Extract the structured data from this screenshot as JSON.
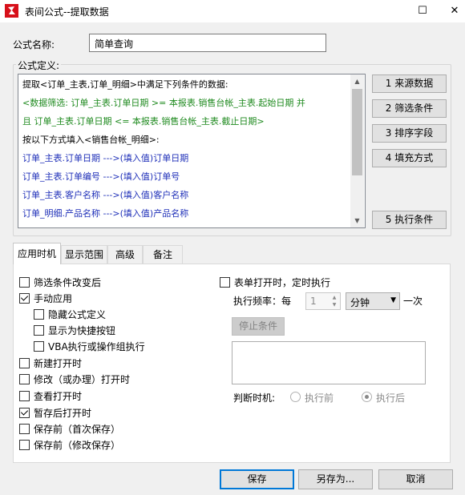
{
  "window": {
    "title": "表间公式--提取数据",
    "maximize_glyph": "☐",
    "close_glyph": "✕"
  },
  "form": {
    "name_label": "公式名称:",
    "name_value": "简单查询",
    "definition_label": "公式定义:"
  },
  "formula": {
    "lines": [
      {
        "color": "black",
        "text": "提取<订单_主表,订单_明细>中满足下列条件的数据:"
      },
      {
        "color": "green",
        "text": "    <数据筛选: 订单_主表.订单日期 >= 本报表.销售台帐_主表.起始日期    并"
      },
      {
        "color": "green",
        "text": "且 订单_主表.订单日期 <= 本报表.销售台帐_主表.截止日期>"
      },
      {
        "color": "black",
        "text": "按以下方式填入<销售台帐_明细>:"
      },
      {
        "color": "blue",
        "text": "订单_主表.订单日期  --->(填入值)订单日期"
      },
      {
        "color": "blue",
        "text": "订单_主表.订单编号  --->(填入值)订单号"
      },
      {
        "color": "blue",
        "text": "订单_主表.客户名称  --->(填入值)客户名称"
      },
      {
        "color": "blue",
        "text": "订单_明细.产品名称  --->(填入值)产品名称"
      }
    ]
  },
  "side_buttons": {
    "source": "1  来源数据",
    "filter": "2  筛选条件",
    "sort": "3  排序字段",
    "fill": "4 填充方式",
    "exec": "5 执行条件"
  },
  "tabs": [
    "应用时机",
    "显示范围",
    "高级",
    "备注"
  ],
  "options": {
    "filter_change": {
      "label": "筛选条件改变后",
      "checked": false
    },
    "manual": {
      "label": "手动应用",
      "checked": true
    },
    "hide_def": {
      "label": "隐藏公式定义",
      "checked": false
    },
    "shortcut": {
      "label": "显示为快捷按钮",
      "checked": false
    },
    "vba": {
      "label": "VBA执行或操作组执行",
      "checked": false
    },
    "on_new": {
      "label": "新建打开时",
      "checked": false
    },
    "on_modify": {
      "label": "修改（或办理）打开时",
      "checked": false
    },
    "on_view": {
      "label": "查看打开时",
      "checked": false
    },
    "on_draft": {
      "label": "暂存后打开时",
      "checked": true
    },
    "before_save_first": {
      "label": "保存前（首次保存）",
      "checked": false
    },
    "before_save_modify": {
      "label": "保存前（修改保存）",
      "checked": false
    },
    "timed": {
      "label": "表单打开时，定时执行",
      "checked": false
    }
  },
  "timer": {
    "freq_label": "执行频率：每",
    "freq_value": "1",
    "unit_value": "分钟",
    "suffix": "一次",
    "stop_button": "停止条件",
    "judge_label": "判断时机:",
    "before_exec": "执行前",
    "after_exec": "执行后",
    "selected": "after"
  },
  "buttons": {
    "save": "保存",
    "save_as": "另存为...",
    "cancel": "取消"
  }
}
